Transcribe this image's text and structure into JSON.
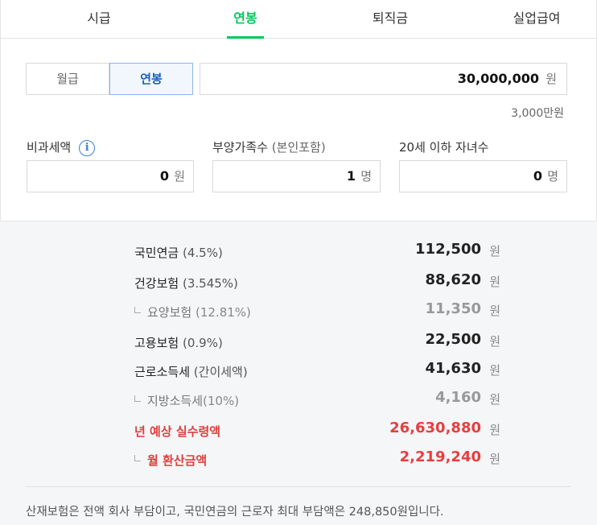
{
  "tabs": [
    {
      "label": "시급"
    },
    {
      "label": "연봉"
    },
    {
      "label": "퇴직금"
    },
    {
      "label": "실업급여"
    }
  ],
  "salary_type": {
    "monthly_label": "월급",
    "annual_label": "연봉",
    "selected": "연봉"
  },
  "salary_input": {
    "value": "30,000,000",
    "unit": "원",
    "hint": "3,000만원"
  },
  "fields": {
    "nontax": {
      "label": "비과세액",
      "value": "0",
      "unit": "원",
      "info_icon": "info-icon"
    },
    "dependents": {
      "label": "부양가족수",
      "label_sub": "(본인포함)",
      "value": "1",
      "unit": "명"
    },
    "children": {
      "label": "20세 이하 자녀수",
      "value": "0",
      "unit": "명"
    }
  },
  "results": [
    {
      "name": "국민연금",
      "pct": "(4.5%)",
      "amount": "112,500",
      "unit": "원",
      "kind": "main"
    },
    {
      "name": "건강보험",
      "pct": "(3.545%)",
      "amount": "88,620",
      "unit": "원",
      "kind": "main"
    },
    {
      "name": "요양보험",
      "pct": "(12.81%)",
      "amount": "11,350",
      "unit": "원",
      "kind": "sub"
    },
    {
      "name": "고용보험",
      "pct": "(0.9%)",
      "amount": "22,500",
      "unit": "원",
      "kind": "main"
    },
    {
      "name": "근로소득세",
      "pct": "(간이세액)",
      "amount": "41,630",
      "unit": "원",
      "kind": "main"
    },
    {
      "name": "지방소득세",
      "pct": "(10%)",
      "amount": "4,160",
      "unit": "원",
      "kind": "sub"
    },
    {
      "name": "년 예상 실수령액",
      "pct": "",
      "amount": "26,630,880",
      "unit": "원",
      "kind": "red"
    },
    {
      "name": "월 환산금액",
      "pct": "",
      "amount": "2,219,240",
      "unit": "원",
      "kind": "red-sub"
    }
  ],
  "note": "산재보험은 전액 회사 부담이고, 국민연금의 근로자 최대 부담액은 248,850원입니다.",
  "colors": {
    "accent_green": "#03c75a",
    "accent_blue": "#1a5fbf",
    "highlight_red": "#e83e3e"
  }
}
